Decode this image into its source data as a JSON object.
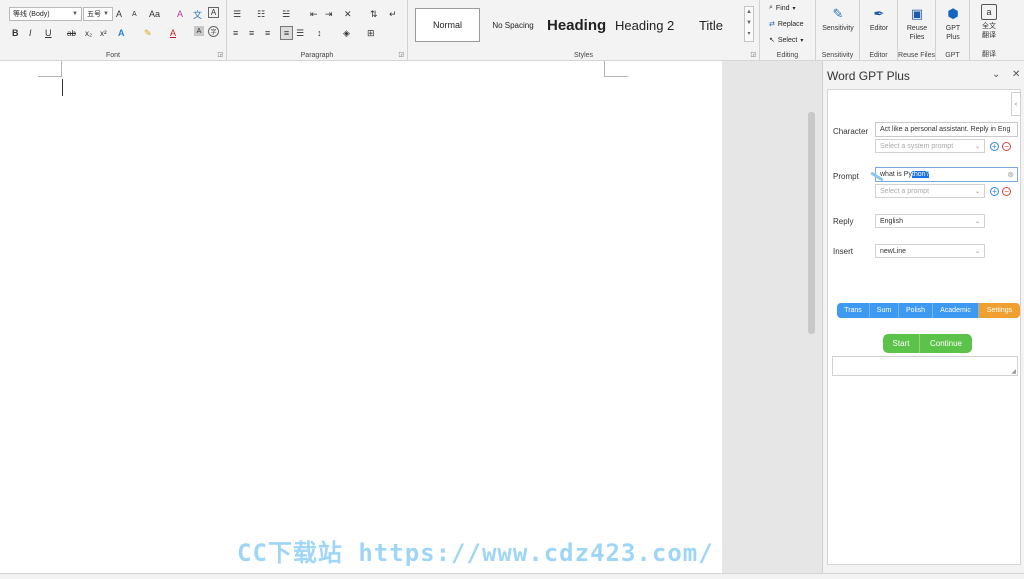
{
  "ribbon": {
    "font": {
      "label": "Font",
      "font_name": "等线 (Body)",
      "font_size": "五号",
      "grow": "A",
      "shrink": "A",
      "case": "Aa",
      "clear": "A",
      "phonetic": "文",
      "border_char": "A",
      "bold": "B",
      "italic": "I",
      "underline": "U",
      "strike": "ab",
      "subscript": "x₂",
      "superscript": "x²",
      "text_effects": "A",
      "highlight": "✎",
      "font_color": "A",
      "shading": "A",
      "enclose": "字"
    },
    "paragraph": {
      "label": "Paragraph"
    },
    "styles": {
      "label": "Styles",
      "items": [
        "Normal",
        "No Spacing",
        "Heading 1",
        "Heading 2",
        "Title"
      ]
    },
    "editing": {
      "label": "Editing",
      "find": "Find",
      "replace": "Replace",
      "select": "Select"
    },
    "sensitivity": {
      "label": "Sensitivity",
      "button": "Sensitivity"
    },
    "editor": {
      "label": "Editor",
      "button": "Editor"
    },
    "reuse": {
      "label": "Reuse Files",
      "button_line1": "Reuse",
      "button_line2": "Files"
    },
    "gpt": {
      "label": "GPT",
      "button_line1": "GPT",
      "button_line2": "Plus"
    },
    "translate": {
      "label": "翻译",
      "button_line1": "全文",
      "button_line2": "翻译"
    }
  },
  "pane": {
    "title": "Word GPT Plus",
    "character_label": "Character",
    "character_value": "Act like a personal assistant. Reply in Eng",
    "system_prompt_placeholder": "Select a system prompt",
    "prompt_label": "Prompt",
    "prompt_prefix": "what is Py",
    "prompt_selected": "thon?",
    "prompt_select_placeholder": "Select a prompt",
    "reply_label": "Reply",
    "reply_value": "English",
    "insert_label": "Insert",
    "insert_value": "newLine",
    "tabs": [
      "Trans",
      "Sum",
      "Polish",
      "Academic",
      "Settings"
    ],
    "start": "Start",
    "continue": "Continue"
  },
  "watermark": "CC下载站 https://www.cdz423.com/",
  "colors": {
    "accent_blue": "#3d99f2",
    "accent_orange": "#f0a030",
    "accent_green": "#5cc34a",
    "minus_red": "#e03e3e"
  }
}
